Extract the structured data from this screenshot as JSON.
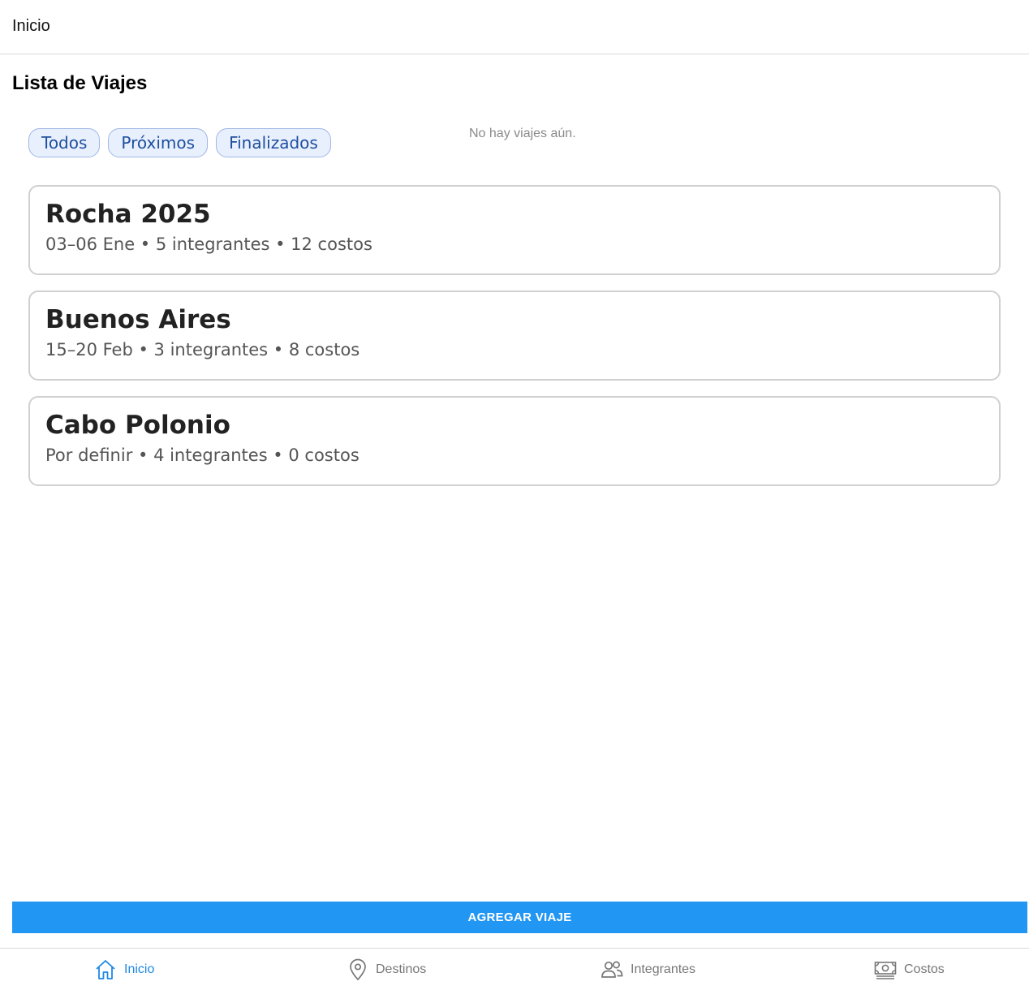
{
  "header": {
    "title": "Inicio"
  },
  "page": {
    "title": "Lista de Viajes",
    "empty_message": "No hay viajes aún."
  },
  "filters": [
    {
      "label": "Todos"
    },
    {
      "label": "Próximos"
    },
    {
      "label": "Finalizados"
    }
  ],
  "trips": [
    {
      "name": "Rocha 2025",
      "meta": "03–06 Ene • 5 integrantes • 12 costos"
    },
    {
      "name": "Buenos Aires",
      "meta": "15–20 Feb • 3 integrantes • 8 costos"
    },
    {
      "name": "Cabo Polonio",
      "meta": "Por definir • 4 integrantes • 0 costos"
    }
  ],
  "actions": {
    "add_trip": "AGREGAR VIAJE"
  },
  "nav": {
    "items": [
      {
        "label": "Inicio",
        "icon": "home-icon",
        "active": true
      },
      {
        "label": "Destinos",
        "icon": "map-pin-icon",
        "active": false
      },
      {
        "label": "Integrantes",
        "icon": "people-icon",
        "active": false
      },
      {
        "label": "Costos",
        "icon": "money-icon",
        "active": false
      }
    ]
  },
  "colors": {
    "accent": "#2196f3",
    "nav_active": "#1e88e5",
    "nav_inactive": "#777777",
    "chip_bg": "#e9f0fd",
    "chip_text": "#1d4e9e",
    "card_border": "#d0d0d0"
  }
}
